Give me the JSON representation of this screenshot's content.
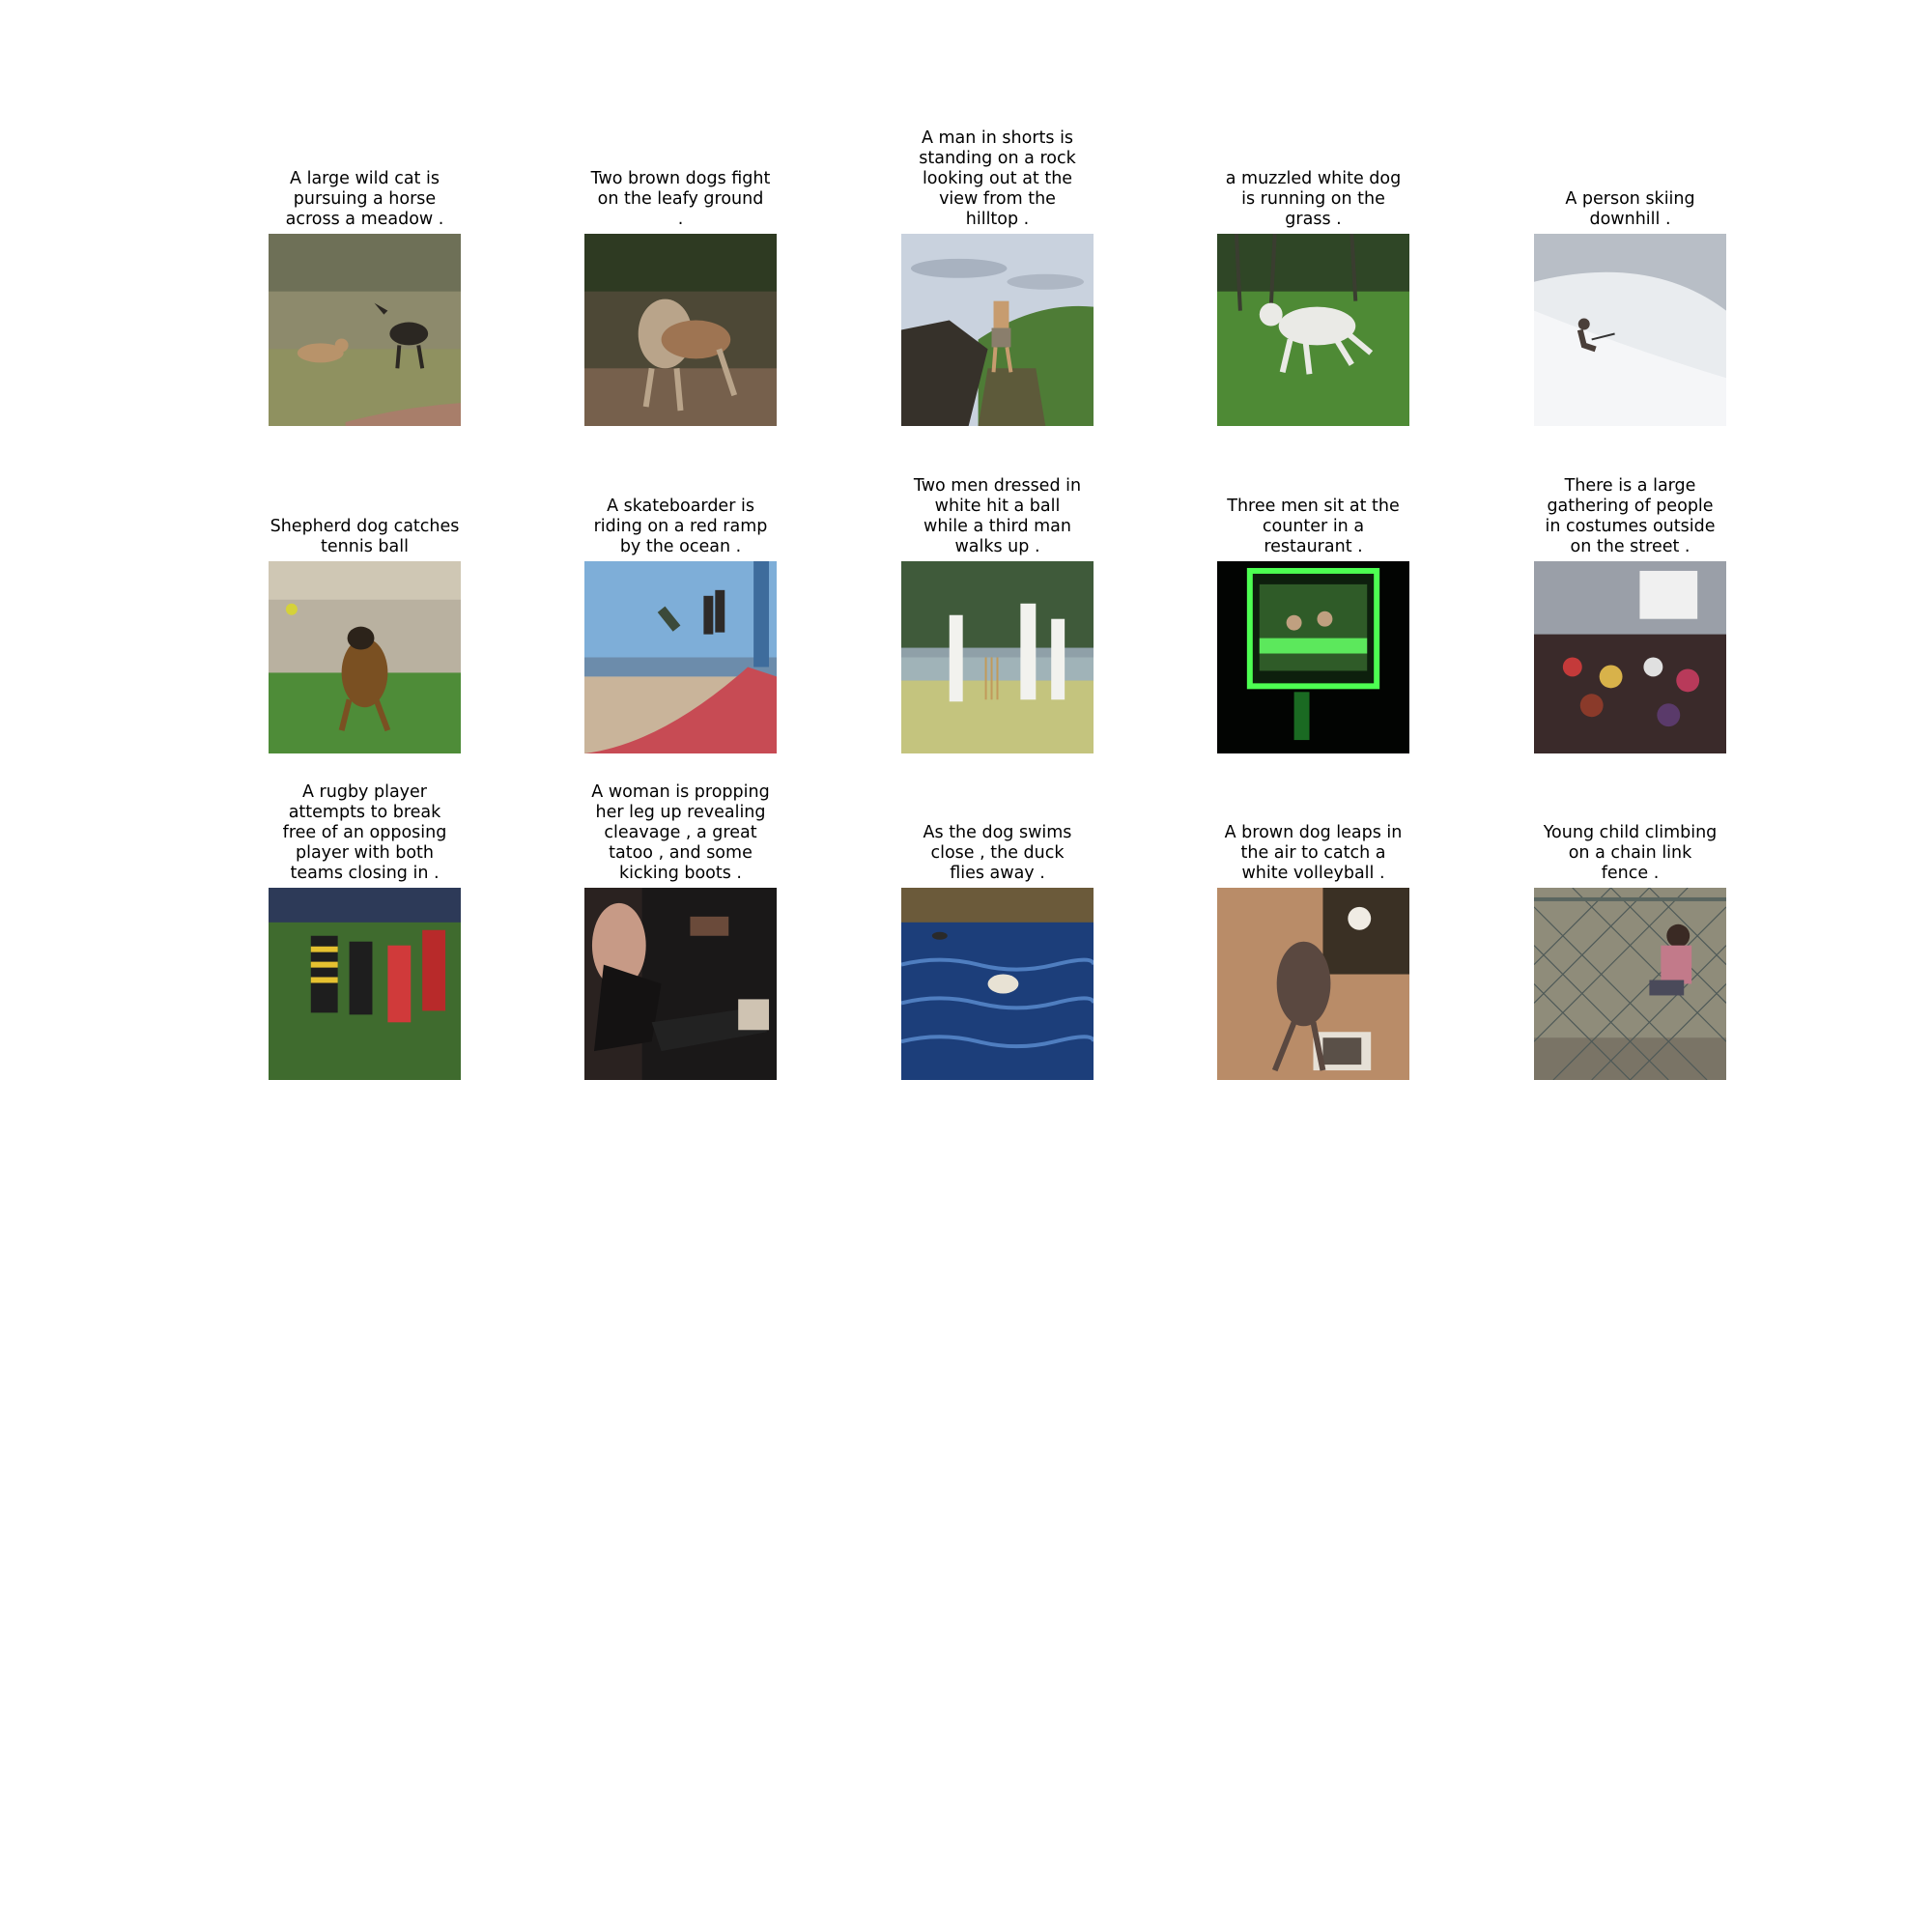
{
  "grid": {
    "items": [
      {
        "caption": "A large wild cat is\npursuing a horse\nacross a meadow .",
        "scene": "lion-chasing-wildebeest"
      },
      {
        "caption": "Two brown dogs fight\non the leafy ground\n.",
        "scene": "two-greyhounds"
      },
      {
        "caption": "A man in shorts is\nstanding on a rock\nlooking out at the\nview from the\nhilltop .",
        "scene": "man-on-rock"
      },
      {
        "caption": "a muzzled white dog\nis running on the\ngrass .",
        "scene": "white-dog-grass"
      },
      {
        "caption": "A person skiing\ndownhill .",
        "scene": "skier-snow"
      },
      {
        "caption": "Shepherd dog catches\ntennis ball",
        "scene": "shepherd-dog"
      },
      {
        "caption": "A skateboarder is\nriding on a red ramp\nby the ocean .",
        "scene": "skate-ramp"
      },
      {
        "caption": "Two men dressed in\nwhite hit a ball\nwhile a third man\nwalks up .",
        "scene": "cricket-players"
      },
      {
        "caption": "Three men sit at the\ncounter in a\nrestaurant .",
        "scene": "green-lit-window"
      },
      {
        "caption": "There is a large\ngathering of people\nin costumes outside\non the street .",
        "scene": "costume-crowd"
      },
      {
        "caption": "A rugby player\nattempts to break\nfree of an opposing\nplayer with both\nteams closing in .",
        "scene": "rugby-match"
      },
      {
        "caption": "A woman is propping\nher leg up revealing\ncleavage , a great\ntatoo , and some\nkicking boots .",
        "scene": "woman-boots"
      },
      {
        "caption": "As the dog swims\nclose , the duck\nflies away .",
        "scene": "dog-swimming"
      },
      {
        "caption": "A brown dog leaps in\nthe air to catch a\nwhite volleyball .",
        "scene": "dog-leaping"
      },
      {
        "caption": "Young child climbing\non a chain link\nfence .",
        "scene": "child-fence"
      }
    ]
  }
}
